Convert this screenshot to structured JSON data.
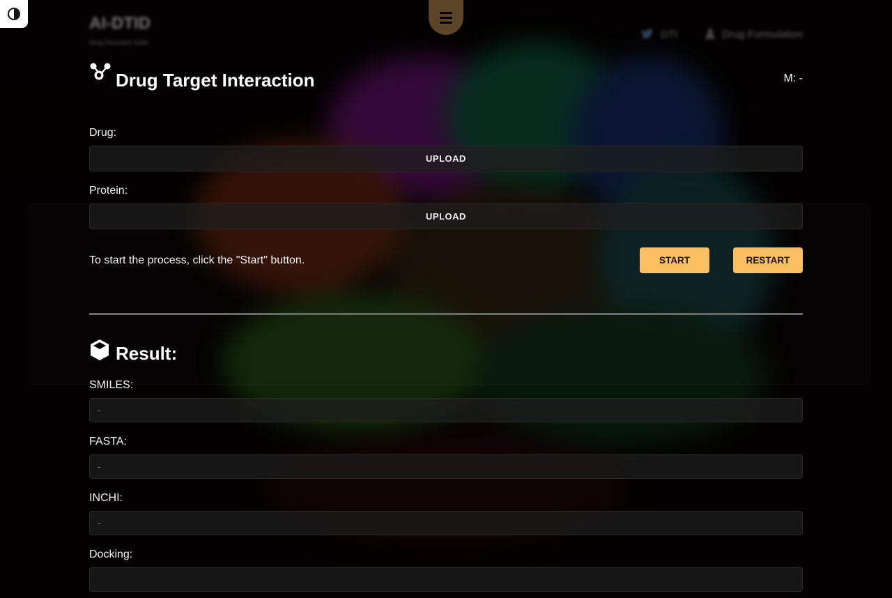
{
  "background_header": {
    "logo": "AI-DTID",
    "tagline": "Drug Discovery Suite",
    "nav": [
      {
        "icon": "twitter-icon",
        "label": "DTI"
      },
      {
        "icon": "flask-icon",
        "label": "Drug Formulation"
      }
    ]
  },
  "theme_toggle": {
    "icon": "contrast-icon"
  },
  "menu": {
    "icon": "hamburger-icon"
  },
  "header": {
    "title": "Drug Target Interaction",
    "icon": "molecule-icon",
    "model_label": "M: -"
  },
  "inputs": {
    "drug_label": "Drug:",
    "drug_button": "UPLOAD",
    "protein_label": "Protein:",
    "protein_button": "UPLOAD"
  },
  "process": {
    "instruction": "To start the process, click the \"Start\" button.",
    "start_button": "START",
    "restart_button": "RESTART"
  },
  "result": {
    "title": "Result:",
    "icon": "cube-icon",
    "smiles_label": "SMILES:",
    "smiles_value": "-",
    "fasta_label": "FASTA:",
    "fasta_value": "-",
    "inchi_label": "INCHI:",
    "inchi_value": "-",
    "docking_label": "Docking:"
  },
  "colors": {
    "accent": "#f9bf61",
    "menu_tab": "#5c4527",
    "background": "#050302"
  }
}
